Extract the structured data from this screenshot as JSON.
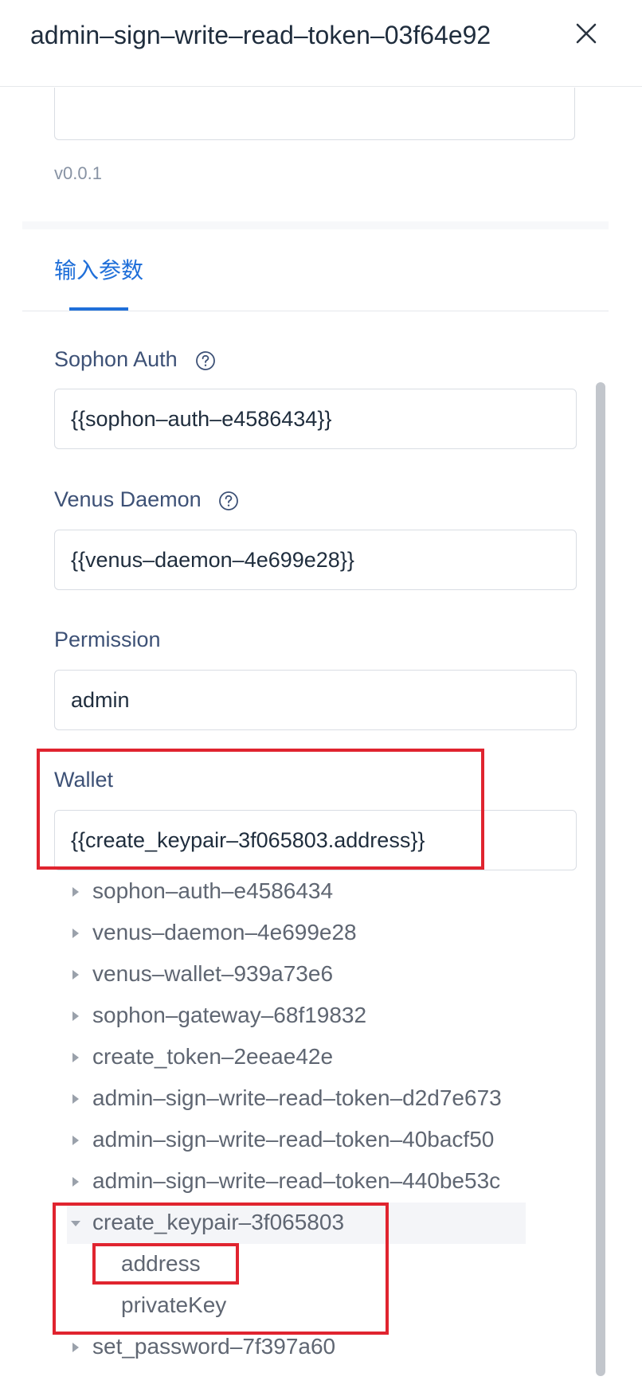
{
  "header": {
    "title": "admin–sign–write–read–token–03f64e92",
    "close_icon": "close-icon"
  },
  "version": "v0.0.1",
  "tabs": [
    {
      "label": "输入参数",
      "active": true
    }
  ],
  "fields": {
    "sophon_auth": {
      "label": "Sophon Auth",
      "value": "{{sophon–auth–e4586434}}",
      "help_icon": "question-circle-icon"
    },
    "venus_daemon": {
      "label": "Venus Daemon",
      "value": "{{venus–daemon–4e699e28}}",
      "help_icon": "question-circle-icon"
    },
    "permission": {
      "label": "Permission",
      "value": "admin"
    },
    "wallet": {
      "label": "Wallet",
      "value": "{{create_keypair–3f065803.address}}"
    }
  },
  "tree": {
    "items": [
      {
        "label": "sophon–auth–e4586434",
        "expanded": false
      },
      {
        "label": "venus–daemon–4e699e28",
        "expanded": false
      },
      {
        "label": "venus–wallet–939a73e6",
        "expanded": false
      },
      {
        "label": "sophon–gateway–68f19832",
        "expanded": false
      },
      {
        "label": "create_token–2eeae42e",
        "expanded": false
      },
      {
        "label": "admin–sign–write–read–token–d2d7e673",
        "expanded": false
      },
      {
        "label": "admin–sign–write–read–token–40bacf50",
        "expanded": false
      },
      {
        "label": "admin–sign–write–read–token–440be53c",
        "expanded": false
      },
      {
        "label": "create_keypair–3f065803",
        "expanded": true
      },
      {
        "label": "set_password–7f397a60",
        "expanded": false
      }
    ],
    "children": [
      "address",
      "privateKey"
    ]
  },
  "colors": {
    "accent": "#1f6fd9",
    "label": "#3d5176",
    "highlight": "#e0242f"
  }
}
